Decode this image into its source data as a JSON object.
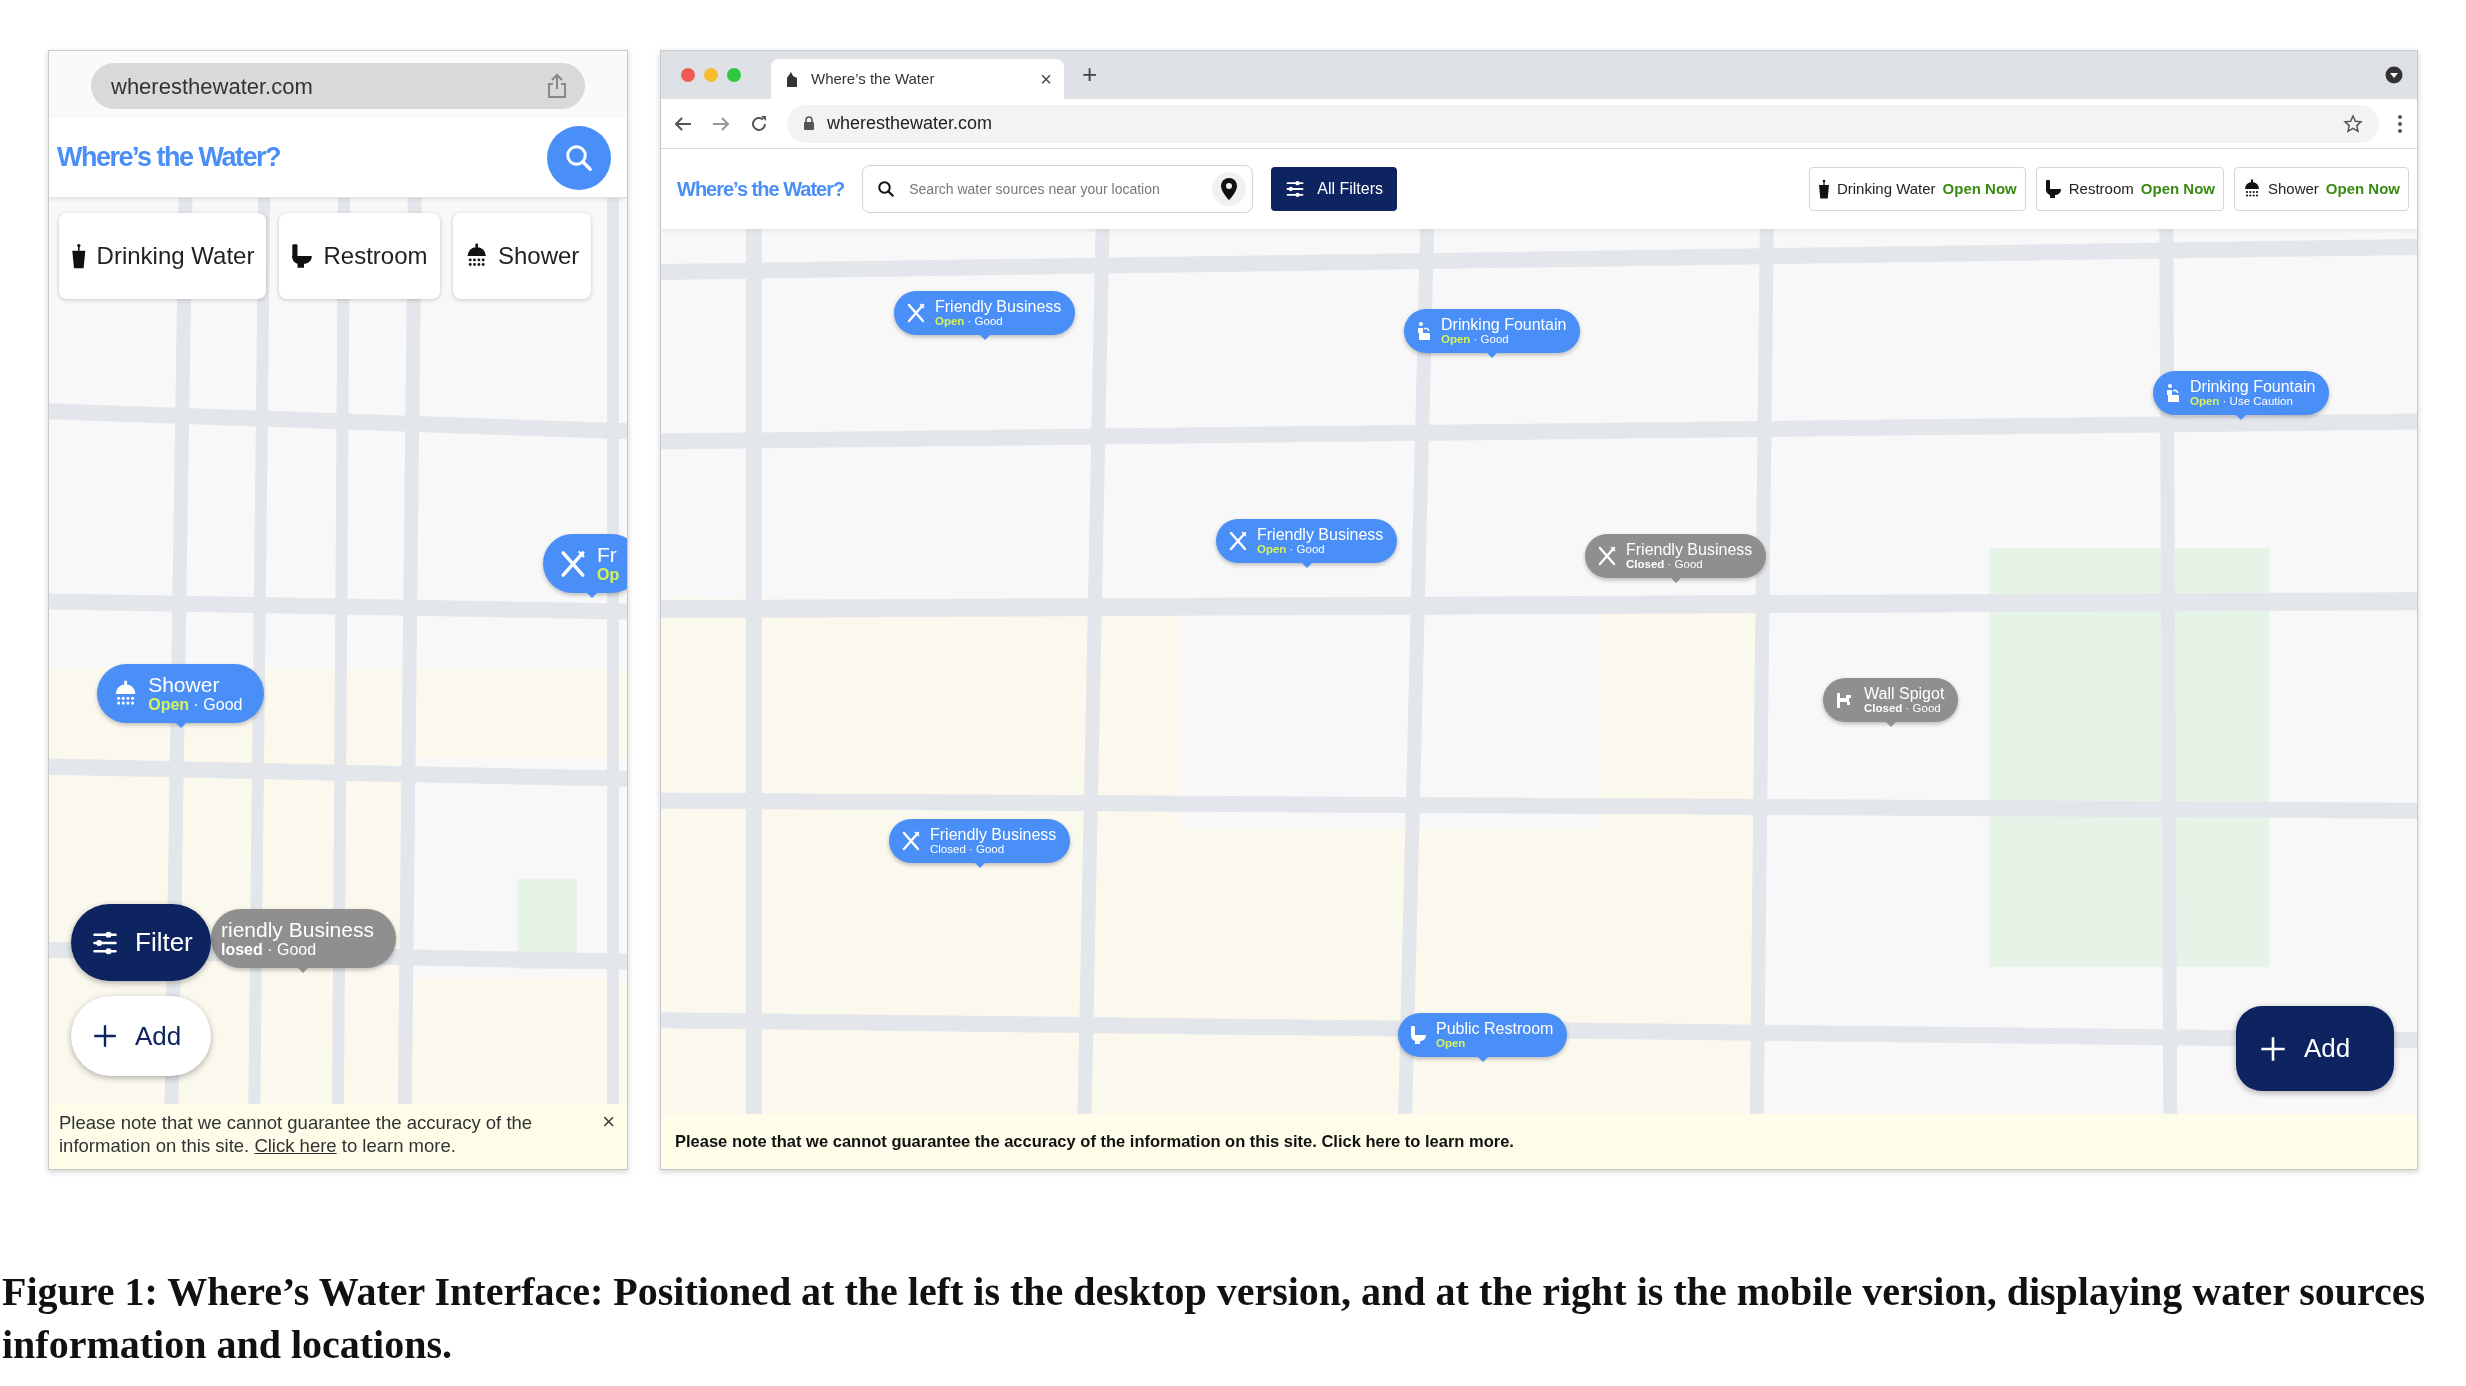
{
  "mobile": {
    "url": "wheresthewater.com",
    "logo": "Where’s the Water?",
    "chips": [
      {
        "kind": "water",
        "label": "Drinking Water"
      },
      {
        "kind": "restroom",
        "label": "Restroom"
      },
      {
        "kind": "shower",
        "label": "Shower"
      }
    ],
    "markers": [
      {
        "kind": "shower",
        "title": "Shower",
        "status": "Open",
        "rating": "· Good",
        "open": true,
        "muted": false
      },
      {
        "kind": "food",
        "title": "Fr",
        "status": "Op",
        "open": true,
        "muted": false
      },
      {
        "title": "riendly Business",
        "status": "losed",
        "rating": "· Good",
        "open": false,
        "muted": true
      }
    ],
    "filter_button": "Filter",
    "add_button": "Add",
    "notice": {
      "before": "Please note that we cannot guarantee the accuracy of the information on this site. ",
      "link": "Click here",
      "after": " to learn more.",
      "close": "×"
    }
  },
  "desktop": {
    "tab_title": "Where’s the Water",
    "tab_close": "×",
    "new_tab": "+",
    "url": "wheresthewater.com",
    "logo": "Where’s the Water?",
    "search": {
      "placeholder": "Search water sources near your location"
    },
    "filters_button": "All Filters",
    "chips": [
      {
        "kind": "water",
        "label": "Drinking Water",
        "status": "Open Now"
      },
      {
        "kind": "restroom",
        "label": "Restroom",
        "status": "Open Now"
      },
      {
        "kind": "shower",
        "label": "Shower",
        "status": "Open Now"
      }
    ],
    "markers": [
      {
        "kind": "food",
        "title": "Friendly Business",
        "status": "Open",
        "rating": "· Good",
        "open": true,
        "muted": false
      },
      {
        "kind": "fountain",
        "title": "Drinking Fountain",
        "status": "Open",
        "rating": "· Good",
        "open": true,
        "muted": false
      },
      {
        "kind": "fountain",
        "title": "Drinking Fountain",
        "status": "Open",
        "rating": "· Use Caution",
        "open": true,
        "muted": false
      },
      {
        "kind": "food",
        "title": "Friendly Business",
        "status": "Open",
        "rating": "· Good",
        "open": true,
        "muted": false
      },
      {
        "kind": "food",
        "title": "Friendly Business",
        "status": "Closed",
        "rating": "· Good",
        "open": false,
        "muted": true
      },
      {
        "kind": "spigot",
        "title": "Wall Spigot",
        "status": "Closed",
        "rating": "· Good",
        "open": false,
        "muted": true
      },
      {
        "kind": "food",
        "title": "Friendly Business",
        "status": "Closed",
        "rating": "· Good",
        "open": false,
        "muted": false
      },
      {
        "kind": "restroom",
        "title": "Public Restroom",
        "status": "Open",
        "open": true,
        "muted": false
      }
    ],
    "add_button": "Add",
    "notice": "Please note that we cannot guarantee the accuracy of the information on this site. Click here to learn more."
  },
  "caption": "Figure 1: Where’s Water Interface: Positioned at the left is the desktop version, and at the right is the mobile version, displaying water sources information and locations."
}
